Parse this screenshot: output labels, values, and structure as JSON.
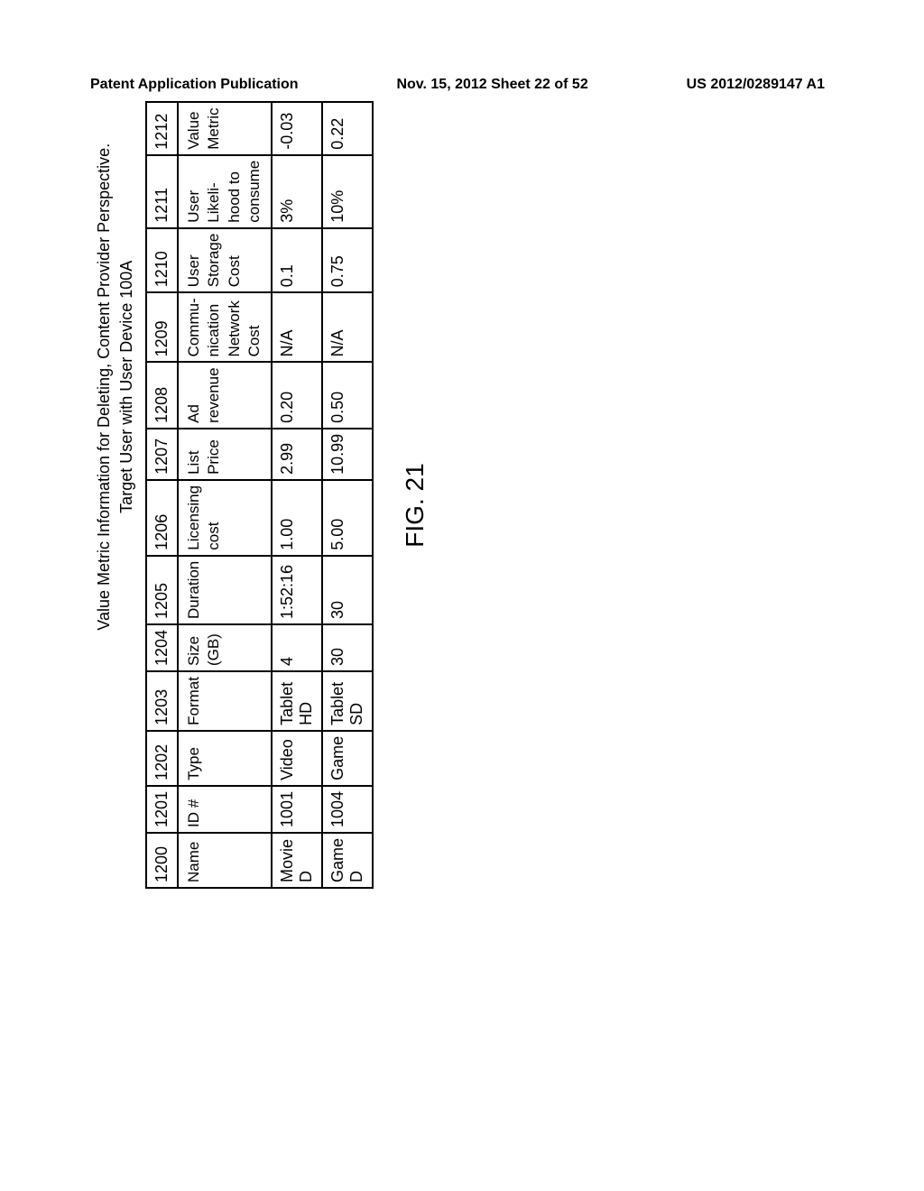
{
  "header": {
    "left": "Patent Application Publication",
    "center": "Nov. 15, 2012  Sheet 22 of 52",
    "right": "US 2012/0289147 A1"
  },
  "table": {
    "title_line1": "Value Metric Information for Deleting, Content Provider Perspective.",
    "title_line2": "Target User with User Device 100A",
    "col_numbers": [
      "1200",
      "1201",
      "1202",
      "1203",
      "1204",
      "1205",
      "1206",
      "1207",
      "1208",
      "1209",
      "1210",
      "1211",
      "1212"
    ],
    "col_labels": [
      "Name",
      "ID #",
      "Type",
      "Format",
      "Size (GB)",
      "Duration",
      "Licensing cost",
      "List Price",
      "Ad revenue",
      "Commu-nication Network Cost",
      "User Storage Cost",
      "User Likeli-hood to consume",
      "Value Metric"
    ],
    "rows": [
      [
        "Movie D",
        "1001",
        "Video",
        "Tablet HD",
        "4",
        "1:52:16",
        "1.00",
        "2.99",
        "0.20",
        "N/A",
        "0.1",
        "3%",
        "-0.03"
      ],
      [
        "Game D",
        "1004",
        "Game",
        "Tablet SD",
        "30",
        "30",
        "5.00",
        "10.99",
        "0.50",
        "N/A",
        "0.75",
        "10%",
        "0.22"
      ]
    ]
  },
  "figure_caption": "FIG. 21"
}
